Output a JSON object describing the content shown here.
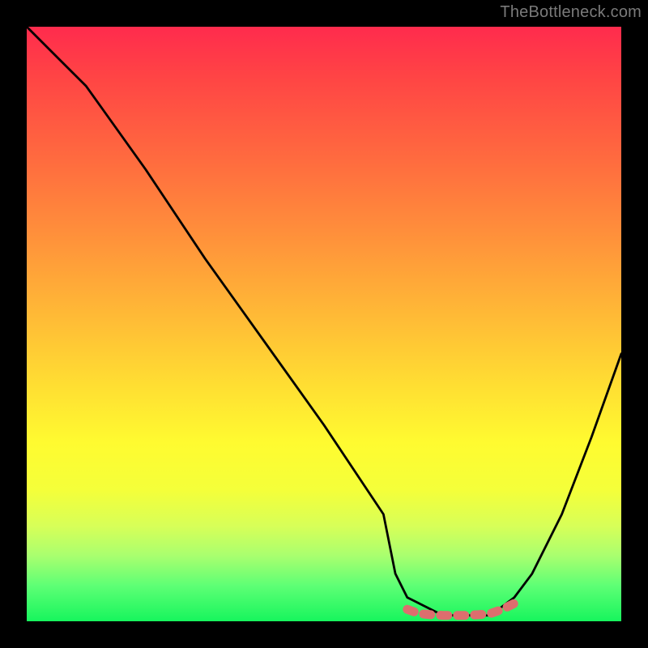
{
  "watermark": "TheBottleneck.com",
  "chart_data": {
    "type": "line",
    "title": "",
    "xlabel": "",
    "ylabel": "",
    "xlim": [
      0,
      100
    ],
    "ylim": [
      0,
      100
    ],
    "grid": false,
    "series": [
      {
        "name": "curve",
        "color": "#000000",
        "x": [
          0,
          5,
          10,
          20,
          30,
          40,
          50,
          60,
          62,
          64,
          70,
          78,
          82,
          85,
          90,
          95,
          100
        ],
        "y": [
          100,
          95,
          90,
          76,
          61,
          47,
          33,
          18,
          8,
          4,
          1,
          1,
          4,
          8,
          18,
          31,
          45
        ]
      },
      {
        "name": "bottom-markers",
        "color": "#e07070",
        "style": "dashed-thick",
        "x": [
          64,
          66,
          68,
          70,
          72,
          74,
          76,
          78,
          80,
          82
        ],
        "y": [
          2,
          1.3,
          1.1,
          1,
          1,
          1,
          1.1,
          1.3,
          2,
          3
        ]
      }
    ],
    "gradient_stops": [
      {
        "pos": 0,
        "color": "#ff2b4d"
      },
      {
        "pos": 0.5,
        "color": "#ffe535"
      },
      {
        "pos": 1,
        "color": "#17f55d"
      }
    ]
  }
}
